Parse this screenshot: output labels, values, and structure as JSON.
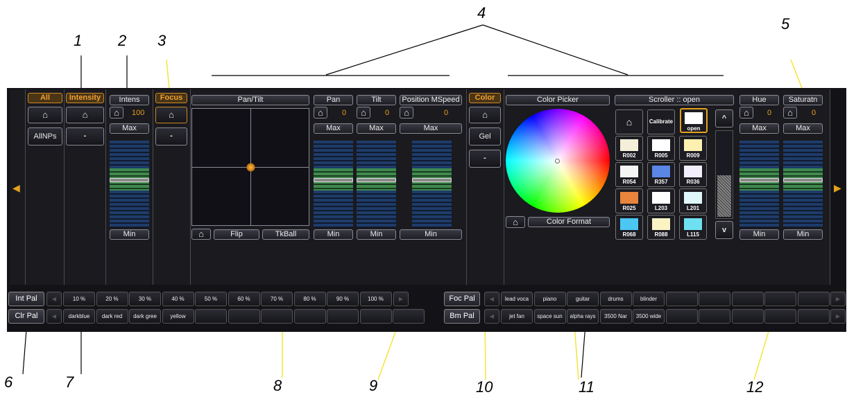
{
  "callouts": [
    "1",
    "2",
    "3",
    "4",
    "5",
    "6",
    "7",
    "8",
    "9",
    "10",
    "11",
    "12"
  ],
  "left_nav_icon": "triangle-left",
  "right_nav_icon": "triangle-right",
  "categories": {
    "all": "All",
    "all_npar": "AllNPs",
    "intensity": "Intensity",
    "intensity_btn": "-",
    "focus": "Focus",
    "focus_btn": "-",
    "color": "Color",
    "color_gel": "Gel",
    "color_btn": "-"
  },
  "home_glyph": "⌂",
  "params": {
    "intens": {
      "label": "Intens",
      "value": "100",
      "max": "Max",
      "min": "Min"
    },
    "pan": {
      "label": "Pan",
      "value": "0",
      "max": "Max",
      "min": "Min"
    },
    "tilt": {
      "label": "Tilt",
      "value": "0",
      "max": "Max",
      "min": "Min"
    },
    "position_mspeed": {
      "label": "Position MSpeed",
      "value": "0",
      "max": "Max",
      "min": "Min"
    },
    "hue": {
      "label": "Hue",
      "value": "0",
      "max": "Max",
      "min": "Min"
    },
    "saturation": {
      "label": "Saturatn",
      "value": "0",
      "max": "Max",
      "min": "Min"
    }
  },
  "pantilt": {
    "label": "Pan/Tilt",
    "flip": "Flip",
    "tkball": "TkBall"
  },
  "color_picker": {
    "label": "Color Picker",
    "format": "Color Format"
  },
  "scroller": {
    "label": "Scroller :: open",
    "calibrate": "Calibrate",
    "open": "open",
    "up": "^",
    "down": "v",
    "swatches": [
      {
        "name": "R002",
        "color": "#f4efd8"
      },
      {
        "name": "R005",
        "color": "#ffffff"
      },
      {
        "name": "R009",
        "color": "#fdf0b0"
      },
      {
        "name": "R054",
        "color": "#f5f5f5"
      },
      {
        "name": "R357",
        "color": "#5a86e6"
      },
      {
        "name": "R036",
        "color": "#f3eefb"
      },
      {
        "name": "R025",
        "color": "#e8843c"
      },
      {
        "name": "L203",
        "color": "#ffffff"
      },
      {
        "name": "L201",
        "color": "#dff6fb"
      },
      {
        "name": "R068",
        "color": "#4cc6f2"
      },
      {
        "name": "R088",
        "color": "#fbf3c4"
      },
      {
        "name": "L115",
        "color": "#6ee0f2"
      }
    ]
  },
  "palettes": {
    "int_pal": "Int Pal",
    "clr_pal": "Clr Pal",
    "foc_pal": "Foc Pal",
    "bm_pal": "Bm Pal",
    "int_items": [
      "10 %",
      "20 %",
      "30 %",
      "40 %",
      "50 %",
      "60 %",
      "70 %",
      "80 %",
      "90 %",
      "100 %"
    ],
    "clr_items": [
      "darkblue",
      "dark red",
      "dark gree",
      "yellow"
    ],
    "foc_items": [
      "lead voca",
      "piano",
      "guitar",
      "drums",
      "blinder"
    ],
    "bm_items": [
      "jet fan",
      "space sun",
      "alpha rays",
      "3500 Nar",
      "3500 wide"
    ]
  }
}
